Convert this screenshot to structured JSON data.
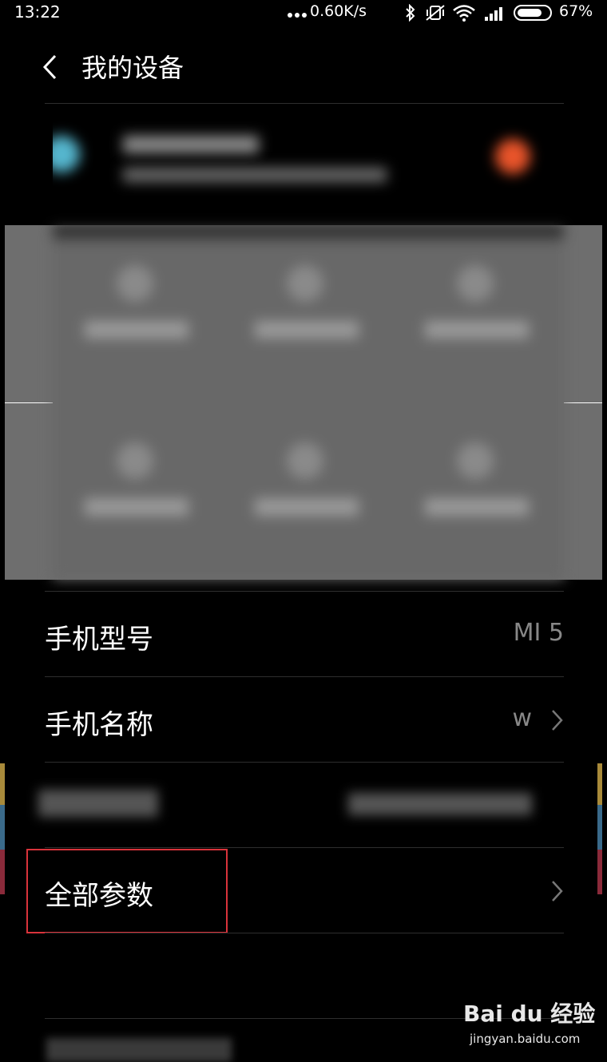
{
  "status_bar": {
    "time": "13:22",
    "network_speed": "0.60K/s",
    "battery_percent": "67%",
    "icons": [
      "more-dots-icon",
      "bluetooth-icon",
      "vibrate-icon",
      "wifi-icon",
      "signal-icon",
      "battery-icon"
    ]
  },
  "header": {
    "title": "我的设备",
    "back_icon": "chevron-left-icon"
  },
  "settings_rows": [
    {
      "label": "手机型号",
      "value": "MI 5",
      "has_chevron": false
    },
    {
      "label": "手机名称",
      "value": "w",
      "has_chevron": true
    },
    {
      "label": "",
      "value": "",
      "has_chevron": true,
      "blurred": true
    },
    {
      "label": "全部参数",
      "value": "",
      "has_chevron": true,
      "highlighted": true
    }
  ],
  "watermark": {
    "logo": "Bai du 经验",
    "url": "jingyan.baidu.com"
  },
  "colors": {
    "background": "#000000",
    "panel_gray": "#686868",
    "highlight_border": "#d9333b",
    "secondary_text": "#888888"
  }
}
